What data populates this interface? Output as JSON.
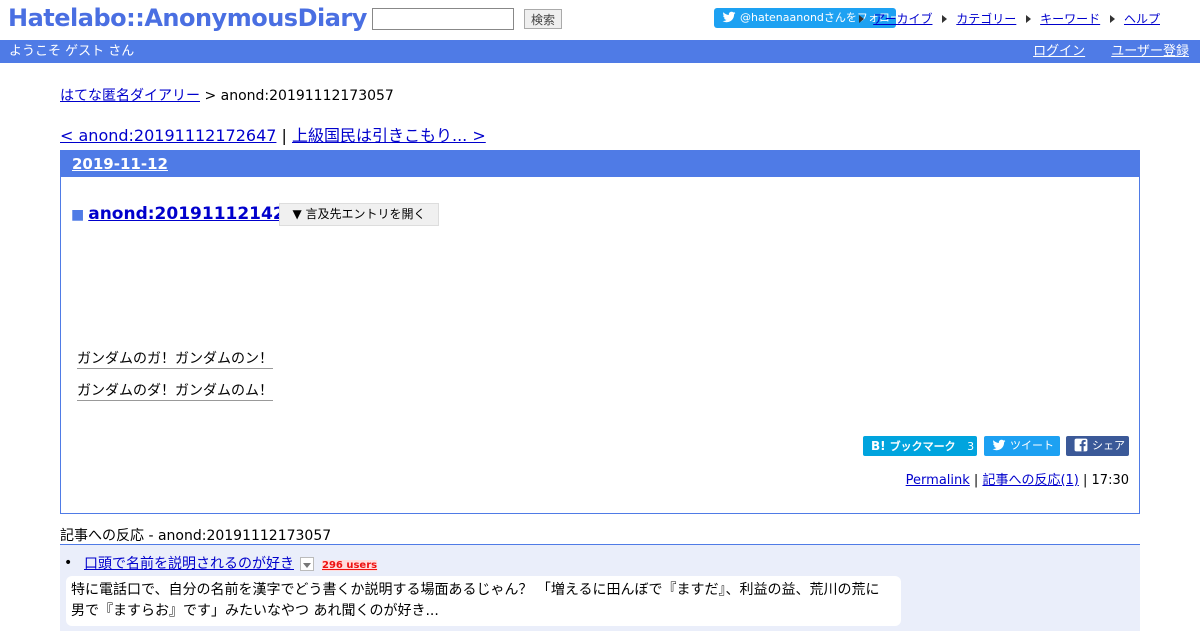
{
  "header": {
    "logo": "Hatelabo::AnonymousDiary",
    "search_value": "",
    "search_button": "検索",
    "follow": "@hatenaanondさんをフォロー",
    "nav": [
      "アーカイブ",
      "カテゴリー",
      "キーワード",
      "ヘルプ"
    ],
    "welcome": "ようこそ ゲスト さん",
    "login": "ログイン",
    "register": "ユーザー登録",
    "accent_color": "#4f7be6"
  },
  "breadcrumb": {
    "home": "はてな匿名ダイアリー",
    "current": " > anond:20191112173057"
  },
  "pager": {
    "prev": "< anond:20191112172647",
    "sep": " | ",
    "next": "上級国民は引きこもり... >"
  },
  "entry": {
    "date": "2019-11-12",
    "title": "anond:20191112142532",
    "open_button": "▼ 言及先エントリを開く",
    "paragraphs": [
      "ガンダムのガ！ガンダムのン！",
      "ガンダムのダ！ガンダムのム！"
    ],
    "share": {
      "bookmark": "ブックマーク",
      "bookmark_count": "3",
      "tweet": "ツイート",
      "facebook": "シェア"
    },
    "footer": {
      "permalink": "Permalink",
      "sep1": " | ",
      "reactions_link": "記事への反応(1)",
      "sep2": " | ",
      "time": "17:30"
    }
  },
  "reactions": {
    "title": "記事への反応 - anond:20191112173057",
    "items": [
      {
        "link": "口頭で名前を説明されるのが好き",
        "users": "296 users",
        "snippet": "特に電話口で、自分の名前を漢字でどう書くか説明する場面あるじゃん？ 「増えるに田んぼで『ますだ』、利益の益、荒川の荒に男で『ますらお』です」みたいなやつ あれ聞くのが好き..."
      }
    ]
  }
}
